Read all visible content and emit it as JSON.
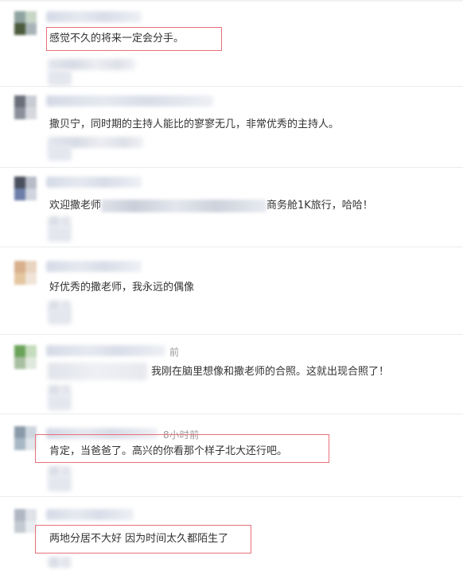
{
  "comments": [
    {
      "text": "感觉不久的将来一定会分手。",
      "time": "",
      "highlighted": true,
      "avatar_colors": [
        "#8fa3a0",
        "#c8d6c8",
        "#4a5a3a",
        "#a8b4b8"
      ]
    },
    {
      "text": "撒贝宁，同时期的主持人能比的寥寥无几，非常优秀的主持人。",
      "time": "",
      "highlighted": false,
      "avatar_colors": [
        "#6a6e78",
        "#c9ccd4",
        "#8a8f9a",
        "#d6d8de"
      ]
    },
    {
      "text_before": "欢迎撒老师",
      "text_after": "商务舱1K旅行，哈哈！",
      "time": "",
      "highlighted": false,
      "avatar_colors": [
        "#4a4f5e",
        "#b7bcc8",
        "#6d7fa8",
        "#cfd4df"
      ]
    },
    {
      "text": "好优秀的撒老师，我永远的偶像",
      "time": "",
      "highlighted": false,
      "avatar_colors": [
        "#d8b08c",
        "#e8d4c0",
        "#e4c6a0",
        "#f0e4d8"
      ]
    },
    {
      "text": "我刚在脑里想像和撒老师的合照。这就出现合照了！",
      "time": "前",
      "highlighted": false,
      "avatar_colors": [
        "#6aa35a",
        "#c4dcbc",
        "#a8bfa0",
        "#dfe8dc"
      ]
    },
    {
      "text": "肯定，当爸爸了。高兴的你看那个样子北大还行吧。",
      "time": "8小时前",
      "highlighted": true,
      "avatar_colors": [
        "#8a9aa8",
        "#cdd6de",
        "#a8b8c4",
        "#e0e6ea"
      ]
    },
    {
      "text": "两地分居不大好 因为时间太久都陌生了",
      "time": "",
      "highlighted": true,
      "avatar_colors": [
        "#b0b8c4",
        "#dfe3e8",
        "#c4cad2",
        "#e9ecf0"
      ]
    }
  ]
}
